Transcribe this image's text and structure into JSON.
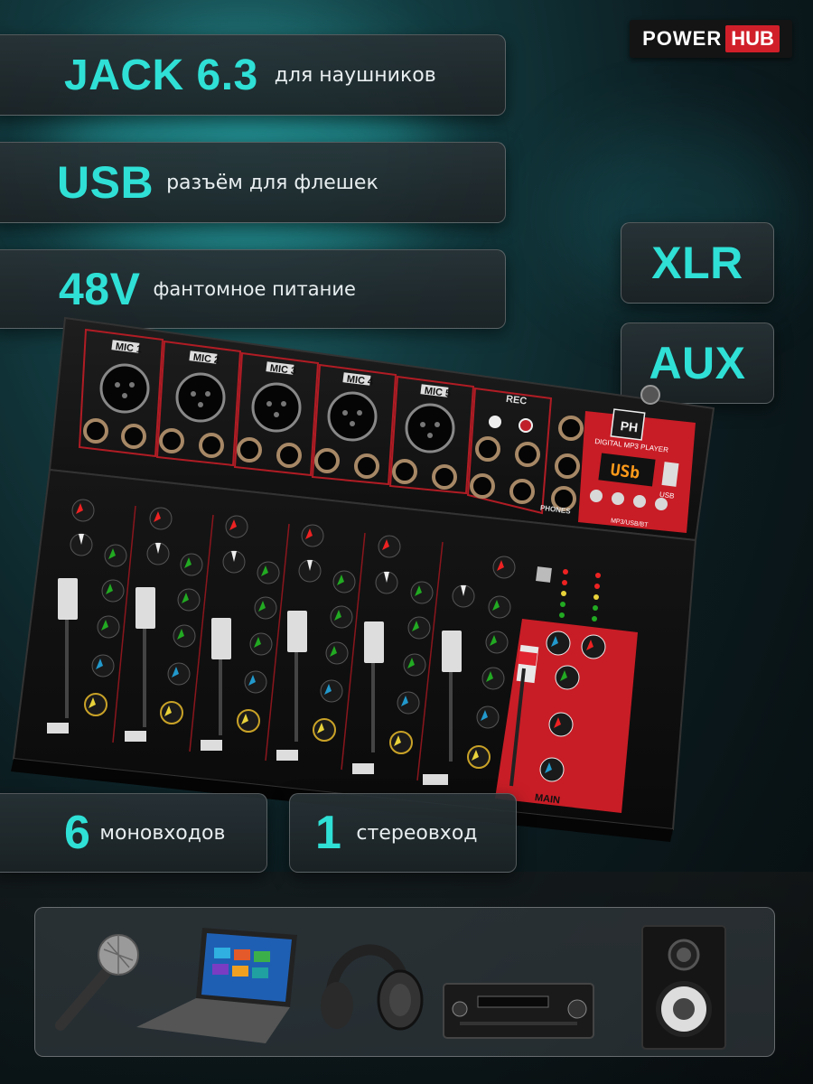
{
  "brand": {
    "part1": "POWER",
    "part2": "HUB"
  },
  "features": {
    "jack": {
      "big": "JACK 6.3",
      "small": "для наушников"
    },
    "usb": {
      "big": "USB",
      "small": "разъём для флешек"
    },
    "phantom": {
      "big": "48V",
      "small": "фантомное питание"
    },
    "xlr": {
      "big": "XLR"
    },
    "aux": {
      "big": "AUX"
    },
    "mono": {
      "big": "6",
      "small": "моновходов"
    },
    "stereo": {
      "big": "1",
      "small": "стереовход"
    }
  },
  "mixer": {
    "channel_labels": [
      "MIC 1",
      "MIC 2",
      "MIC 3",
      "MIC 4",
      "MIC 5"
    ],
    "rec_label": "REC",
    "player_title": "DIGITAL MP3 PLAYER",
    "display_text": "USb",
    "usb_port_label": "USB",
    "player_sub": "MP3/USB/BT",
    "main_label": "MAIN",
    "phones_label": "PHONES",
    "ph_logo": "PH"
  },
  "devices": [
    "microphone-icon",
    "laptop-icon",
    "headphones-icon",
    "receiver-icon",
    "speaker-icon"
  ],
  "colors": {
    "accent": "#2fe0d6",
    "red": "#d11f2a"
  }
}
